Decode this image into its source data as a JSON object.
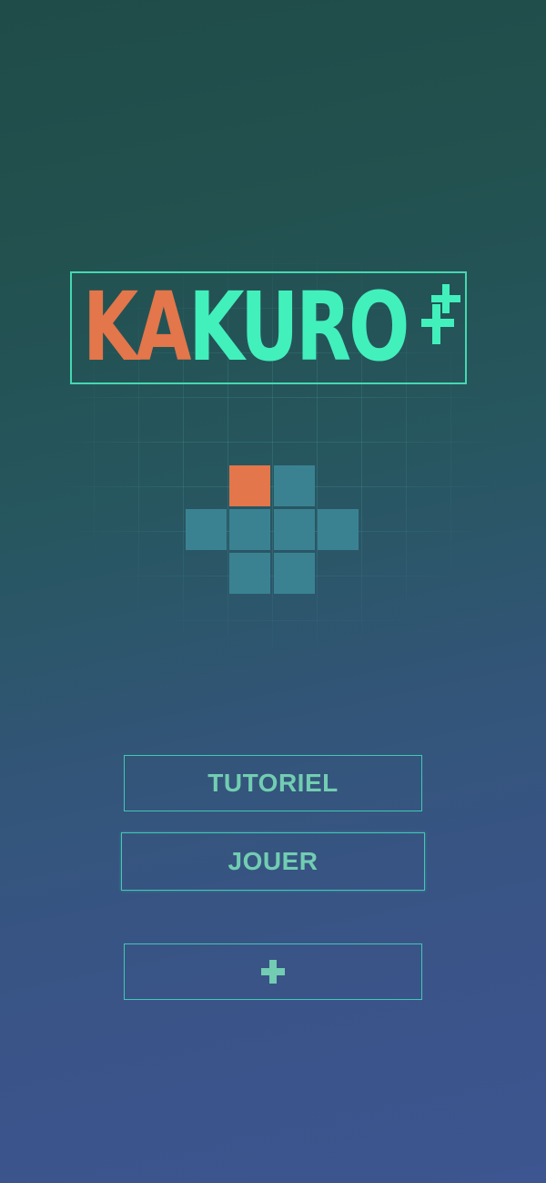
{
  "logo": {
    "part_orange": "KA",
    "part_green": "KURO",
    "suffix_icon": "double-plus-icon"
  },
  "puzzle": {
    "cells": [
      {
        "color": "orange"
      },
      {
        "color": "teal"
      },
      {
        "color": "teal"
      },
      {
        "color": "teal"
      },
      {
        "color": "teal"
      },
      {
        "color": "teal"
      },
      {
        "color": "teal"
      },
      {
        "color": "teal"
      }
    ]
  },
  "menu": {
    "tutorial_label": "TUTORIEL",
    "play_label": "JOUER",
    "more_icon": "plus-icon"
  },
  "colors": {
    "accent_orange": "#e3764a",
    "accent_green": "#42f0bc",
    "tile_teal": "#3a8292",
    "button_text": "#72cdb2",
    "button_border": "#40c9b5"
  }
}
